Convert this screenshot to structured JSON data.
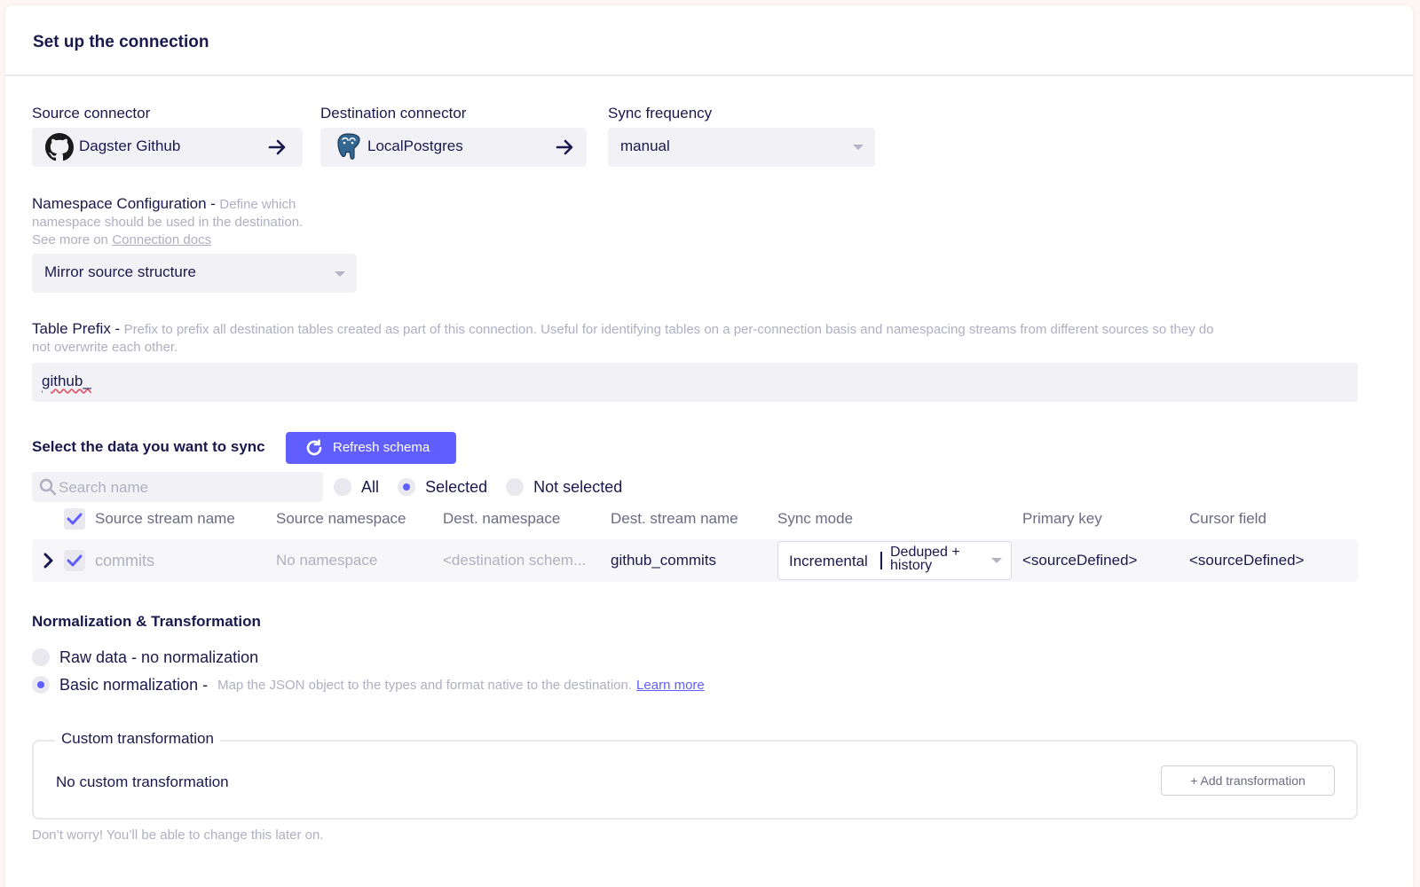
{
  "header": {
    "title": "Set up the connection"
  },
  "source": {
    "label": "Source connector",
    "value": "Dagster Github",
    "icon": "github-icon"
  },
  "destination": {
    "label": "Destination connector",
    "value": "LocalPostgres",
    "icon": "postgres-icon"
  },
  "sync_frequency": {
    "label": "Sync frequency",
    "value": "manual"
  },
  "namespace": {
    "label": "Namespace Configuration -",
    "hint_line1": "Define which",
    "hint_line2": "namespace should be used in the destination.",
    "see_more": "See more on",
    "docs_link": "Connection docs",
    "value": "Mirror source structure"
  },
  "table_prefix": {
    "label": "Table Prefix -",
    "hint_line1": "Prefix to prefix all destination tables created as part of this connection. Useful for identifying tables on a per-connection basis and namespacing streams from different sources so they do",
    "hint_line2": "not overwrite each other.",
    "value": "github_"
  },
  "sync_select": {
    "label": "Select the data you want to sync",
    "refresh_button": "Refresh schema",
    "search_placeholder": "Search name",
    "filters": [
      {
        "label": "All",
        "selected": false
      },
      {
        "label": "Selected",
        "selected": true
      },
      {
        "label": "Not selected",
        "selected": false
      }
    ]
  },
  "table": {
    "headers": {
      "source_stream": "Source stream name",
      "source_namespace": "Source namespace",
      "dest_namespace": "Dest. namespace",
      "dest_stream": "Dest. stream name",
      "sync_mode": "Sync mode",
      "primary_key": "Primary key",
      "cursor_field": "Cursor field"
    },
    "rows": [
      {
        "stream": "commits",
        "source_namespace": "No namespace",
        "dest_namespace": "<destination schem...",
        "dest_stream": "github_commits",
        "sync_mode_left": "Incremental",
        "sync_mode_right_1": "Deduped +",
        "sync_mode_right_2": "history",
        "primary_key": "<sourceDefined>",
        "cursor_field": "<sourceDefined>"
      }
    ]
  },
  "normalization": {
    "title": "Normalization & Transformation",
    "options": [
      {
        "label": "Raw data - no normalization",
        "selected": false
      },
      {
        "label": "Basic normalization -",
        "selected": true
      }
    ],
    "basic_hint": "Map the JSON object to the types and format native to the destination.",
    "learn_more": "Learn more"
  },
  "custom_transformation": {
    "legend": "Custom transformation",
    "empty_text": "No custom transformation",
    "add_button": "+ Add transformation"
  },
  "footer_note": "Don’t worry! You’ll be able to change this later on.",
  "colors": {
    "accent": "#615eff",
    "text": "#1a194d",
    "muted": "#afafc1",
    "field_bg": "#f2f2f6"
  }
}
